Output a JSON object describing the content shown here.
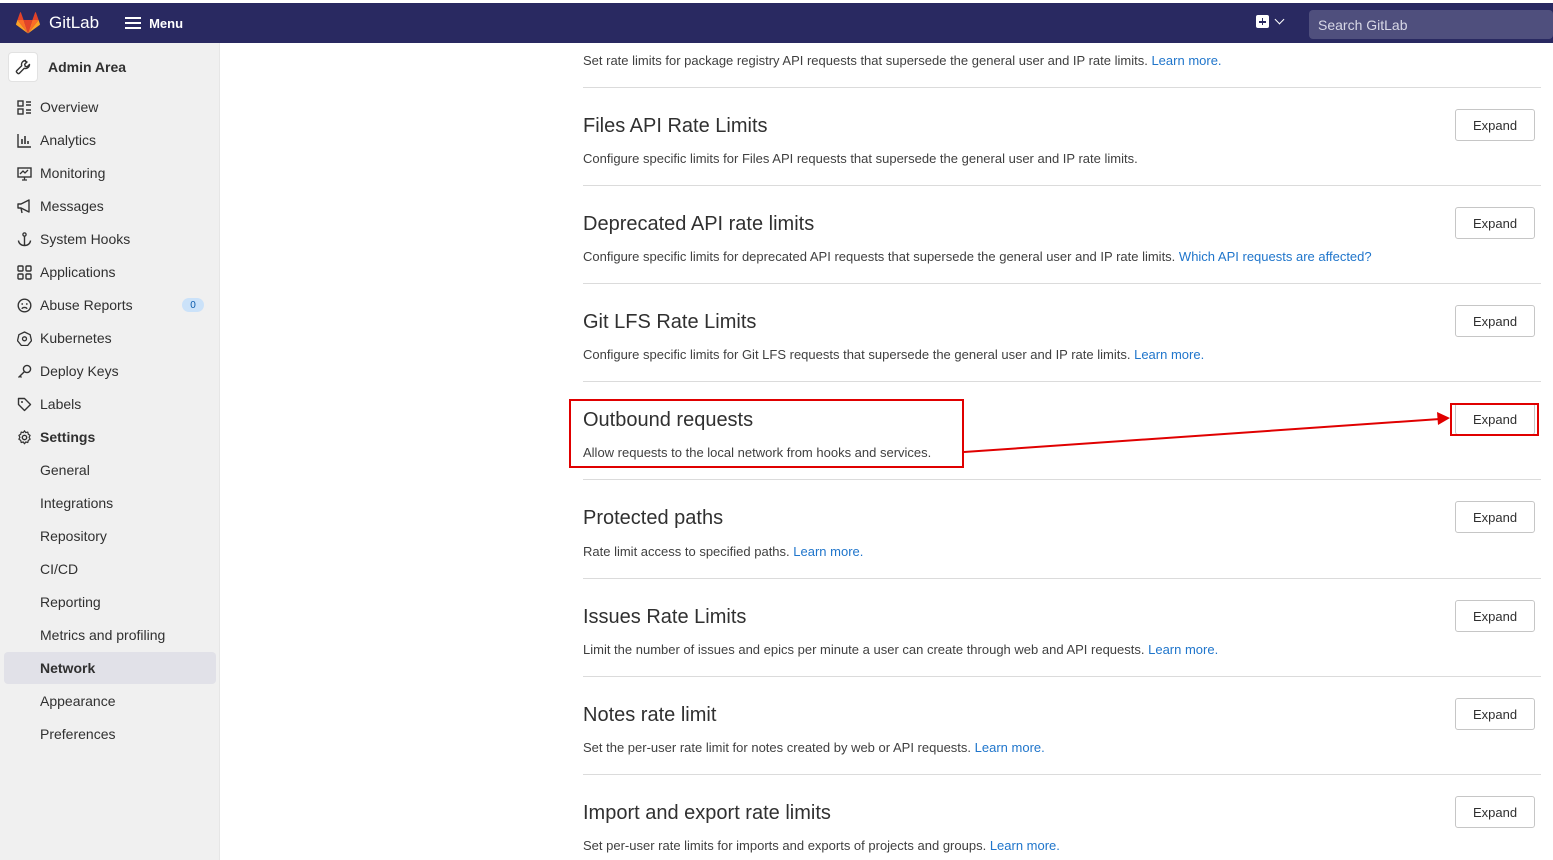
{
  "navbar": {
    "brand": "GitLab",
    "menu_label": "Menu",
    "search_placeholder": "Search GitLab",
    "brand_color": "#292961"
  },
  "sidebar": {
    "header": "Admin Area",
    "items": [
      {
        "label": "Overview",
        "icon": "overview-icon"
      },
      {
        "label": "Analytics",
        "icon": "analytics-icon"
      },
      {
        "label": "Monitoring",
        "icon": "monitoring-icon"
      },
      {
        "label": "Messages",
        "icon": "megaphone-icon"
      },
      {
        "label": "System Hooks",
        "icon": "anchor-icon"
      },
      {
        "label": "Applications",
        "icon": "applications-icon"
      },
      {
        "label": "Abuse Reports",
        "icon": "abuse-icon",
        "badge": "0"
      },
      {
        "label": "Kubernetes",
        "icon": "kubernetes-icon"
      },
      {
        "label": "Deploy Keys",
        "icon": "key-icon"
      },
      {
        "label": "Labels",
        "icon": "label-icon"
      },
      {
        "label": "Settings",
        "icon": "gear-icon"
      }
    ],
    "settings_children": [
      "General",
      "Integrations",
      "Repository",
      "CI/CD",
      "Reporting",
      "Metrics and profiling",
      "Network",
      "Appearance",
      "Preferences"
    ],
    "active_item": "Network"
  },
  "main": {
    "first_desc": "Set rate limits for package registry API requests that supersede the general user and IP rate limits.",
    "first_link": "Learn more.",
    "expand_label": "Expand",
    "sections": [
      {
        "title": "Files API Rate Limits",
        "desc": "Configure specific limits for Files API requests that supersede the general user and IP rate limits.",
        "link": ""
      },
      {
        "title": "Deprecated API rate limits",
        "desc": "Configure specific limits for deprecated API requests that supersede the general user and IP rate limits.",
        "link": "Which API requests are affected?"
      },
      {
        "title": "Git LFS Rate Limits",
        "desc": "Configure specific limits for Git LFS requests that supersede the general user and IP rate limits.",
        "link": "Learn more."
      },
      {
        "title": "Outbound requests",
        "desc": "Allow requests to the local network from hooks and services.",
        "link": ""
      },
      {
        "title": "Protected paths",
        "desc": "Rate limit access to specified paths.",
        "link": "Learn more."
      },
      {
        "title": "Issues Rate Limits",
        "desc": "Limit the number of issues and epics per minute a user can create through web and API requests.",
        "link": "Learn more."
      },
      {
        "title": "Notes rate limit",
        "desc": "Set the per-user rate limit for notes created by web or API requests.",
        "link": "Learn more."
      },
      {
        "title": "Import and export rate limits",
        "desc": "Set per-user rate limits for imports and exports of projects and groups.",
        "link": "Learn more."
      }
    ]
  },
  "annotation_color": "#e00000"
}
